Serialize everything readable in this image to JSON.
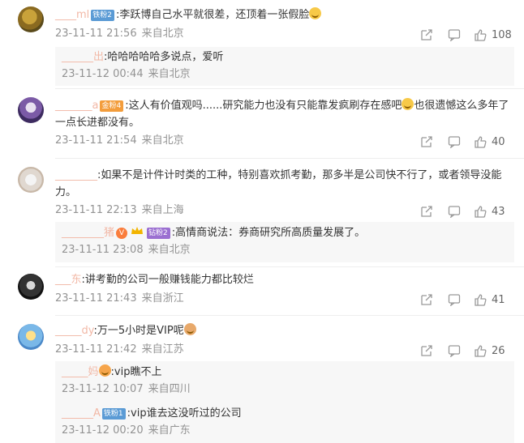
{
  "comments": [
    {
      "user": "____ml",
      "badge": "铁粉2",
      "text": ":李跃博自己水平就很差，还顶着一张假脸",
      "time": "23-11-11 21:56",
      "location": "来自北京",
      "likes": "108",
      "replies": [
        {
          "user": "______出",
          "text": ":哈哈哈哈哈多说点，爱听",
          "time": "23-11-12 00:44",
          "location": "来自北京"
        }
      ]
    },
    {
      "user": "_______a",
      "badge": "金粉4",
      "text": ":这人有价值观吗......研究能力也没有只能靠发疯刷存在感吧",
      "text2": "也很遗憾这么多年了一点长进都没有。",
      "time": "23-11-11 21:54",
      "location": "来自北京",
      "likes": "40"
    },
    {
      "user": "________",
      "text": ":如果不是计件计时类的工种，特别喜欢抓考勤，那多半是公司快不行了，或者领导没能力。",
      "time": "23-11-11 22:13",
      "location": "来自上海",
      "likes": "43",
      "replies": [
        {
          "user": "________猪",
          "badge": "钻粉2",
          "text": ":高情商说法：券商研究所高质量发展了。",
          "time": "23-11-11 23:08",
          "location": "来自北京"
        }
      ]
    },
    {
      "user": "___东",
      "text": ":讲考勤的公司一般赚钱能力都比较烂",
      "time": "23-11-11 21:43",
      "location": "来自浙江",
      "likes": "41"
    },
    {
      "user": "_____dy",
      "text": ":万一5小时是VIP呢",
      "time": "23-11-11 21:42",
      "location": "来自江苏",
      "likes": "26",
      "replies": [
        {
          "user": "_____妈",
          "text": ":vip瞧不上",
          "time": "23-11-12 10:07",
          "location": "来自四川"
        },
        {
          "user": "______A",
          "badge": "铁粉1",
          "text": ":vip谁去这没听过的公司",
          "time": "23-11-12 00:20",
          "location": "来自广东"
        }
      ]
    }
  ],
  "icon_names": [
    "share-icon",
    "reply-icon",
    "like-icon"
  ],
  "colors": {
    "username": "#eb7350",
    "meta": "#939393",
    "reply_bg": "#f7f7f7"
  }
}
